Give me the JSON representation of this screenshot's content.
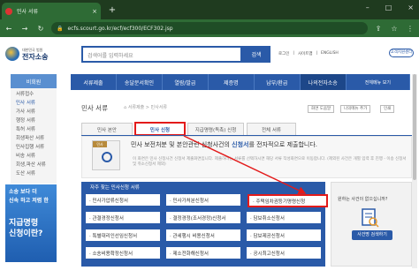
{
  "browser": {
    "tab_title": "민사 서류",
    "new_tab": "+",
    "url": "ecfs.scourt.go.kr/ecf/ecf300/ECF302.jsp",
    "back": "←",
    "forward": "→",
    "reload": "↻",
    "lock": "🔒",
    "share": "⇪",
    "star": "☆",
    "menu": "⋮",
    "minimize": "–",
    "maximize": "□",
    "close": "×"
  },
  "site": {
    "logo_small": "대한민국 법원",
    "logo_big": "전자소송",
    "search_placeholder": "검색어를 입력하세요",
    "search_button": "검색",
    "top_links": [
      "로그인",
      "|",
      "사이트맵",
      "|",
      "ENGLISH"
    ],
    "top_badge": "고객지원센터"
  },
  "nav": [
    "서류제출",
    "송달문서확인",
    "열람/발급",
    "제증명",
    "납부/환급",
    "나의전자소송",
    "전체메뉴 보기"
  ],
  "sidebar": {
    "title": "비회원",
    "items": [
      "서류접수",
      "민사 서류",
      "가사 서류",
      "행정 서류",
      "특허 서류",
      "회생파산 서류",
      "민사집행 서류",
      "비송 서류",
      "회생,파산 서류",
      "도산 서류"
    ]
  },
  "banner": {
    "line1": "소송 보다 더",
    "line2": "신속 하고 저렴 한",
    "line3": "지급명령",
    "line4": "신청이란?"
  },
  "content": {
    "page_title": "민사 서류",
    "breadcrumb": "⌂ 서류제출 > 민사서류",
    "util_buttons": [
      "화면 도움말",
      "나의메뉴 추가",
      "인쇄"
    ],
    "subtabs": [
      "민사 본안",
      "민사 신청",
      "지급명령(독촉) 신청",
      "전체 서류"
    ],
    "icon_flag": "민사",
    "info_title_pre": "민사 보전처분 및 본안관련 신청사건의 ",
    "info_title_em": "신청서",
    "info_title_post": "를 전자적으로 제출합니다.",
    "info_sub": "이 화면은 민사 신청사건 신청서 제출화면입니다. 제출하려는 서류를 선택하시면 해당 서류 작성화면으로 이동합니다. (제외된 사건은 개별 입력 후 진행 - 이송 신청서 및 취소신청서 제외)"
  },
  "panel": {
    "title": "자주 찾는 민사신청 서류",
    "cells": [
      "· 민사가압류신청서",
      "· 민사가처분신청서",
      "· 주택임차권등기명령신청",
      "· 관결경정신청서",
      "· 결정경정(조서경정)신청서",
      "· 담보취소신청서",
      "· 특별대리인선임신청서",
      "· 관세행시 비용신청서",
      "· 담보제공신청서",
      "· 소송비용확정신청서",
      "· 제소전화해신청서",
      "· 공시최고신청서"
    ]
  },
  "side": {
    "title": "원하는 사건이 없으십니까?",
    "button": "사건명 검색하기"
  },
  "colors": {
    "accent": "#2a5aa8",
    "highlight": "#e31b1b",
    "browser_chrome": "#2e6b35"
  }
}
